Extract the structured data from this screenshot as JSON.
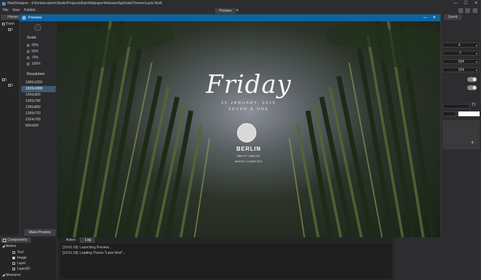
{
  "window": {
    "title": "RainDesigner - d:\\Embarcadero\\Studio\\Projects\\RainWallpaper\\Release\\AppData\\Themes\\Lasix Mod\\",
    "controls": [
      "—",
      "☐",
      "✕"
    ]
  },
  "menu": {
    "items": [
      "File",
      "View",
      "Publish"
    ],
    "center_tab": "Preview"
  },
  "hierarchy": {
    "tab": "Hierarc",
    "rows": [
      "Them",
      "L",
      "L",
      "L",
      "L",
      "L"
    ]
  },
  "preview": {
    "title": "Preview",
    "controls": [
      "—",
      "✕"
    ],
    "scale": {
      "label": "Scale",
      "options": [
        "30%",
        "50%",
        "70%",
        "100%"
      ]
    },
    "resolution": {
      "label": "Resolution",
      "options": [
        "1680x1050",
        "1920x1080",
        "1400x900",
        "1366x768",
        "1280x800",
        "1280x720",
        "1024x768",
        "800x600"
      ],
      "selected": "1920x1080"
    },
    "make_preview": "Make Preview",
    "wallpaper": {
      "day": "Friday",
      "date": "25 JANUARY, 2019",
      "time": "SEVEN & ONE",
      "city": "BERLIN",
      "minmax": "MIN:1°F | MAX:33°",
      "weather": "MOSTLY CLEAR 33°C"
    }
  },
  "properties": {
    "tab": "Event",
    "fields": [
      "4",
      "-7",
      "694",
      "224"
    ],
    "font_icon": "Tт"
  },
  "components": {
    "tab": "Components",
    "groups": {
      "meters": "Meters",
      "measures": "Measures"
    },
    "items": [
      "Text",
      "Image",
      "Layer",
      "Layer3D"
    ],
    "checked": [
      false,
      true,
      false,
      false
    ]
  },
  "console": {
    "tabs": [
      "Action",
      "Log"
    ],
    "active_tab": "Log",
    "lines": [
      "[19:01:18]: Launching Preview...",
      "[19:01:18]: Loading Theme \"Lasix Mod\"..."
    ]
  }
}
